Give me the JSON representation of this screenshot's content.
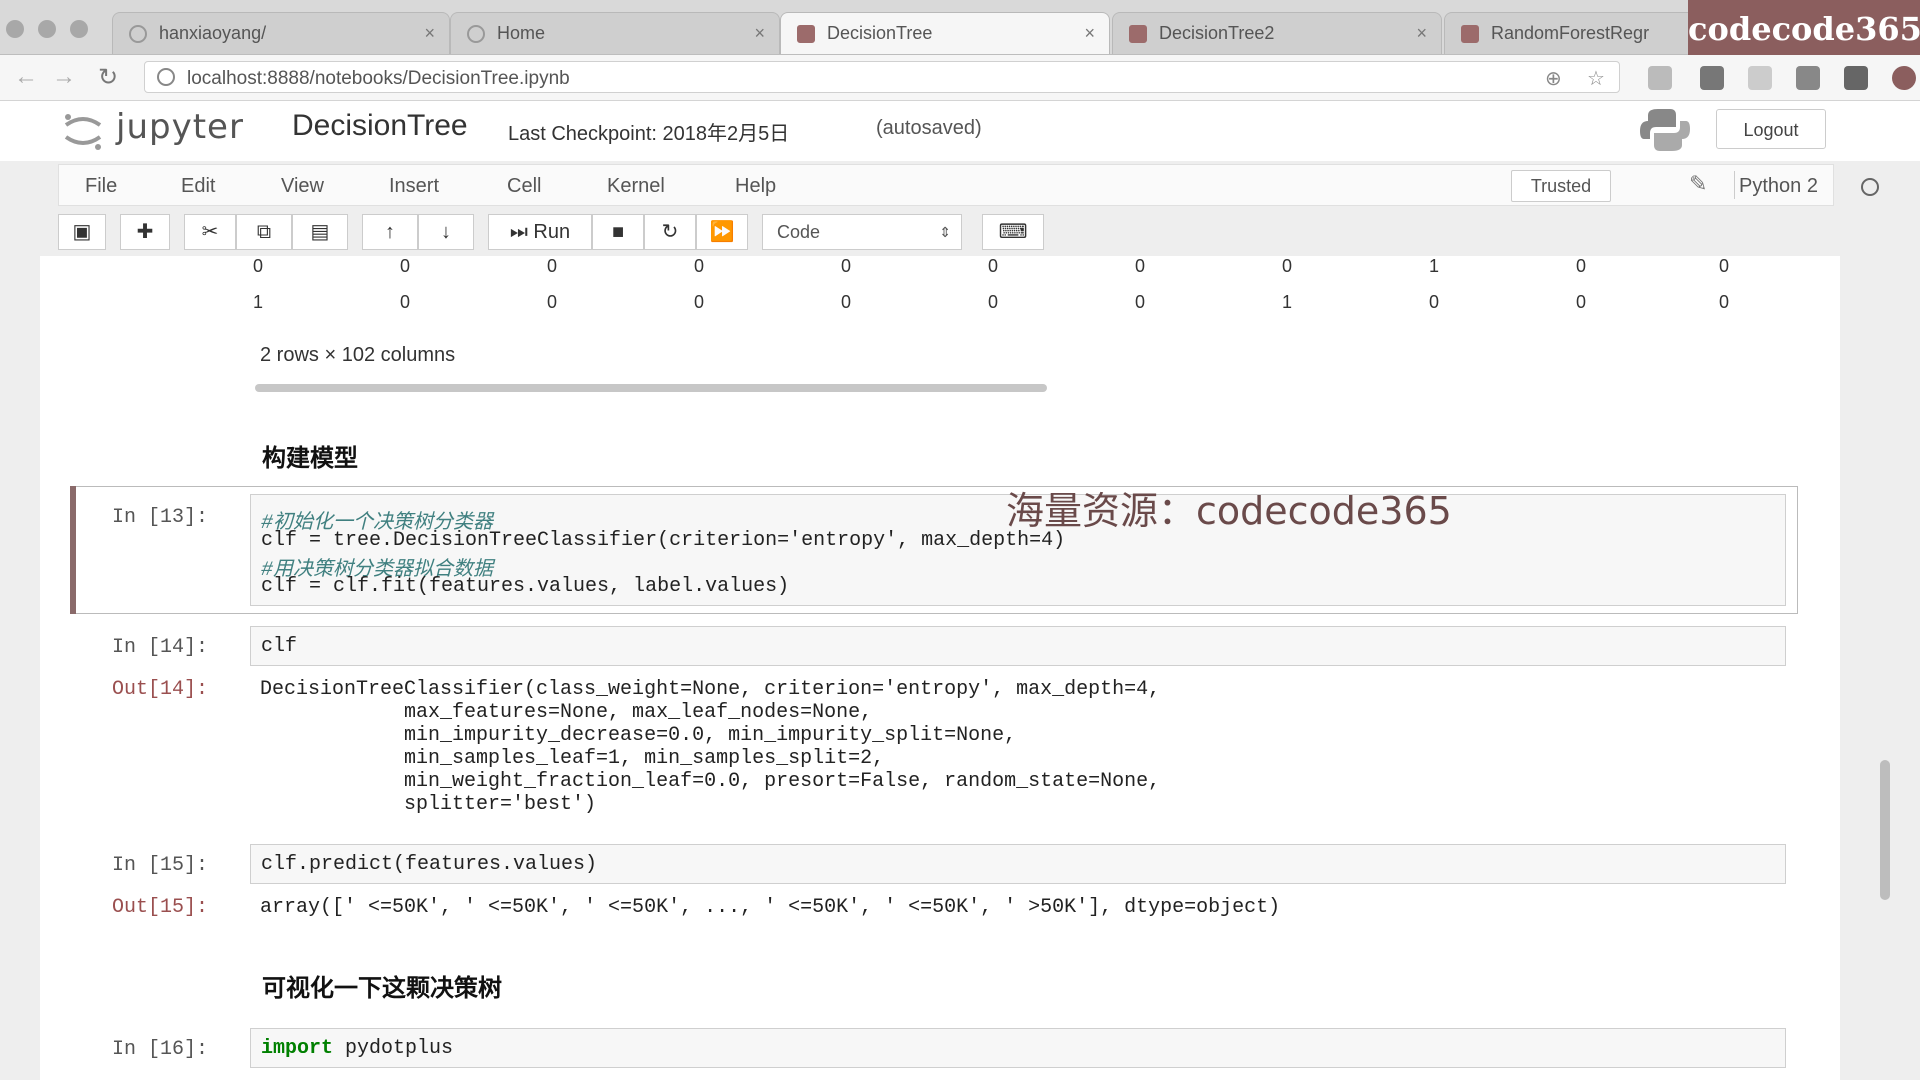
{
  "browser": {
    "tabs": [
      {
        "label": "hanxiaoyang/",
        "close": "×"
      },
      {
        "label": "Home",
        "close": "×"
      },
      {
        "label": "DecisionTree",
        "close": "×"
      },
      {
        "label": "DecisionTree2",
        "close": "×"
      },
      {
        "label": "RandomForestRegr"
      }
    ],
    "url": "localhost:8888/notebooks/DecisionTree.ipynb",
    "brand": "codecode365"
  },
  "jupyter": {
    "logo_text": "jupyter",
    "notebook_name": "DecisionTree",
    "checkpoint": "Last Checkpoint: 2018年2月5日",
    "autosaved": "(autosaved)",
    "logout": "Logout",
    "menu": [
      "File",
      "Edit",
      "View",
      "Insert",
      "Cell",
      "Kernel",
      "Help"
    ],
    "trusted": "Trusted",
    "kernel": "Python 2",
    "toolbar": {
      "run": "Run",
      "cell_type": "Code"
    }
  },
  "dataframe": {
    "rows": [
      [
        "0",
        "0",
        "0",
        "0",
        "0",
        "0",
        "0",
        "0",
        "1",
        "0",
        "0"
      ],
      [
        "1",
        "0",
        "0",
        "0",
        "0",
        "0",
        "0",
        "1",
        "0",
        "0",
        "0"
      ]
    ],
    "info": "2 rows × 102 columns"
  },
  "headings": {
    "build_model": "构建模型",
    "visualize": "可视化一下这颗决策树"
  },
  "cells": {
    "c13": {
      "prompt": "In [13]:",
      "comment1": "#初始化一个决策树分类器",
      "line2": "clf = tree.DecisionTreeClassifier(criterion='entropy', max_depth=4)",
      "comment3": "#用决策树分类器拟合数据",
      "line4": "clf = clf.fit(features.values, label.values)"
    },
    "c14": {
      "prompt": "In [14]:",
      "code": "clf",
      "out_prompt": "Out[14]:",
      "out_lines": [
        "DecisionTreeClassifier(class_weight=None, criterion='entropy', max_depth=4,",
        "            max_features=None, max_leaf_nodes=None,",
        "            min_impurity_decrease=0.0, min_impurity_split=None,",
        "            min_samples_leaf=1, min_samples_split=2,",
        "            min_weight_fraction_leaf=0.0, presort=False, random_state=None,",
        "            splitter='best')"
      ]
    },
    "c15": {
      "prompt": "In [15]:",
      "code": "clf.predict(features.values)",
      "out_prompt": "Out[15]:",
      "output": "array([' <=50K', ' <=50K', ' <=50K', ..., ' <=50K', ' <=50K', ' >50K'], dtype=object)"
    },
    "c16": {
      "prompt": "In [16]:",
      "kw": "import",
      "rest": " pydotplus"
    }
  },
  "watermark": "海量资源：codecode365"
}
